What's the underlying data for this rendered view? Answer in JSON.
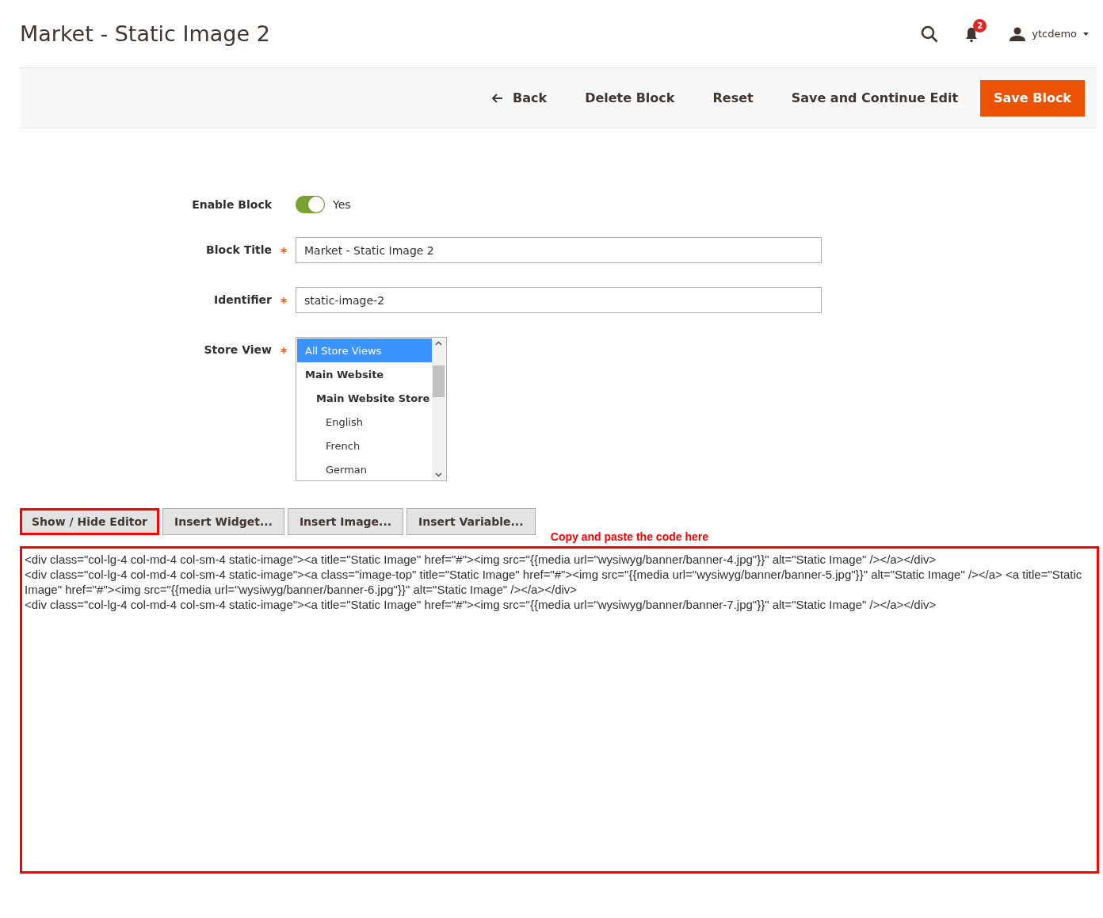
{
  "header": {
    "title": "Market - Static Image 2",
    "notifications_count": "2",
    "user": "ytcdemo"
  },
  "toolbar": {
    "buttons": [
      {
        "label": "Back",
        "kind": "back"
      },
      {
        "label": "Delete Block",
        "kind": "plain"
      },
      {
        "label": "Reset",
        "kind": "plain"
      },
      {
        "label": "Save and Continue Edit",
        "kind": "plain"
      },
      {
        "label": "Save Block",
        "kind": "primary"
      }
    ]
  },
  "form": {
    "enable": {
      "label": "Enable Block",
      "on": true,
      "value": "Yes"
    },
    "fields": [
      {
        "label": "Block Title",
        "required": true,
        "value": "Market - Static Image 2"
      },
      {
        "label": "Identifier",
        "required": true,
        "value": "static-image-2"
      }
    ],
    "store_view": {
      "label": "Store View",
      "required": true,
      "options": [
        {
          "label": "All Store Views",
          "selected": true
        },
        {
          "label": "Main Website",
          "selected": false,
          "children": [
            {
              "label": "Main Website Store",
              "selected": false,
              "children": [
                {
                  "label": "English",
                  "selected": false
                },
                {
                  "label": "French",
                  "selected": false
                },
                {
                  "label": "German",
                  "selected": false
                }
              ]
            }
          ]
        }
      ]
    }
  },
  "editor": {
    "buttons": [
      {
        "label": "Show / Hide Editor",
        "highlighted": true
      },
      {
        "label": "Insert Widget...",
        "highlighted": false
      },
      {
        "label": "Insert Image...",
        "highlighted": false
      },
      {
        "label": "Insert Variable...",
        "highlighted": false
      }
    ],
    "annotation": "Copy and paste the code here",
    "code_lines": [
      "<div class=\"col-lg-4 col-md-4 col-sm-4 static-image\"><a title=\"Static Image\" href=\"#\"><img src=\"{{media url=\"wysiwyg/banner/banner-4.jpg\"}}\" alt=\"Static Image\" /></a></div>",
      "<div class=\"col-lg-4 col-md-4 col-sm-4 static-image\"><a class=\"image-top\" title=\"Static Image\" href=\"#\"><img src=\"{{media url=\"wysiwyg/banner/banner-5.jpg\"}}\" alt=\"Static Image\" /></a> <a title=\"Static Image\" href=\"#\"><img src=\"{{media url=\"wysiwyg/banner/banner-6.jpg\"}}\" alt=\"Static Image\" /></a></div>",
      "<div class=\"col-lg-4 col-md-4 col-sm-4 static-image\"><a title=\"Static Image\" href=\"#\"><img src=\"{{media url=\"wysiwyg/banner/banner-7.jpg\"}}\" alt=\"Static Image\" /></a></div>"
    ],
    "highlighted": true
  }
}
